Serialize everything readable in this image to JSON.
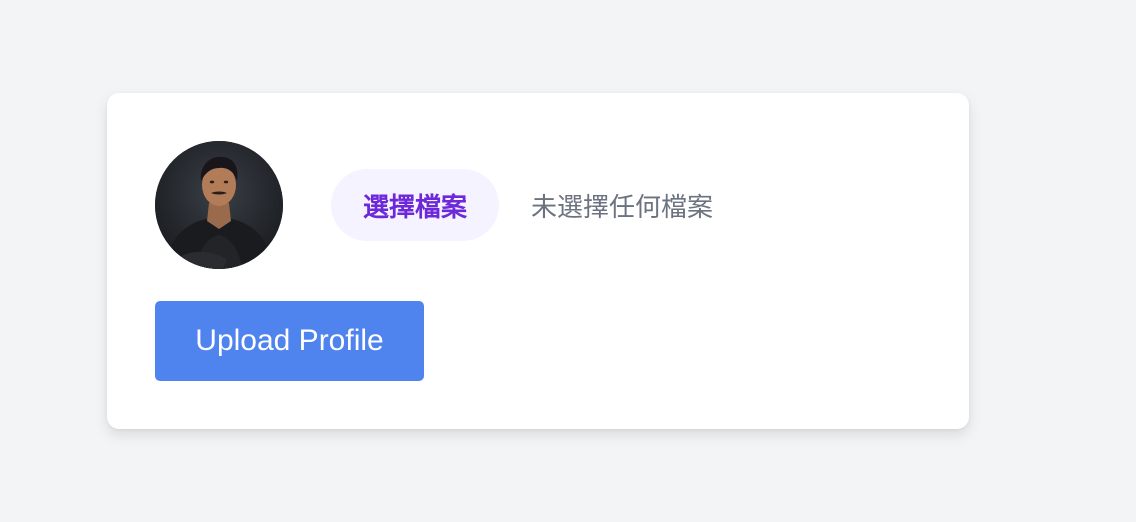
{
  "profile_form": {
    "avatar_icon": "profile-photo",
    "file_input": {
      "button_label": "選擇檔案",
      "status_text": "未選擇任何檔案"
    },
    "upload_button_label": "Upload Profile"
  },
  "colors": {
    "page_background": "#f3f4f6",
    "card_background": "#ffffff",
    "file_button_bg": "#f5f3ff",
    "file_button_text": "#6d28d9",
    "upload_button_bg": "#4f83ee"
  }
}
